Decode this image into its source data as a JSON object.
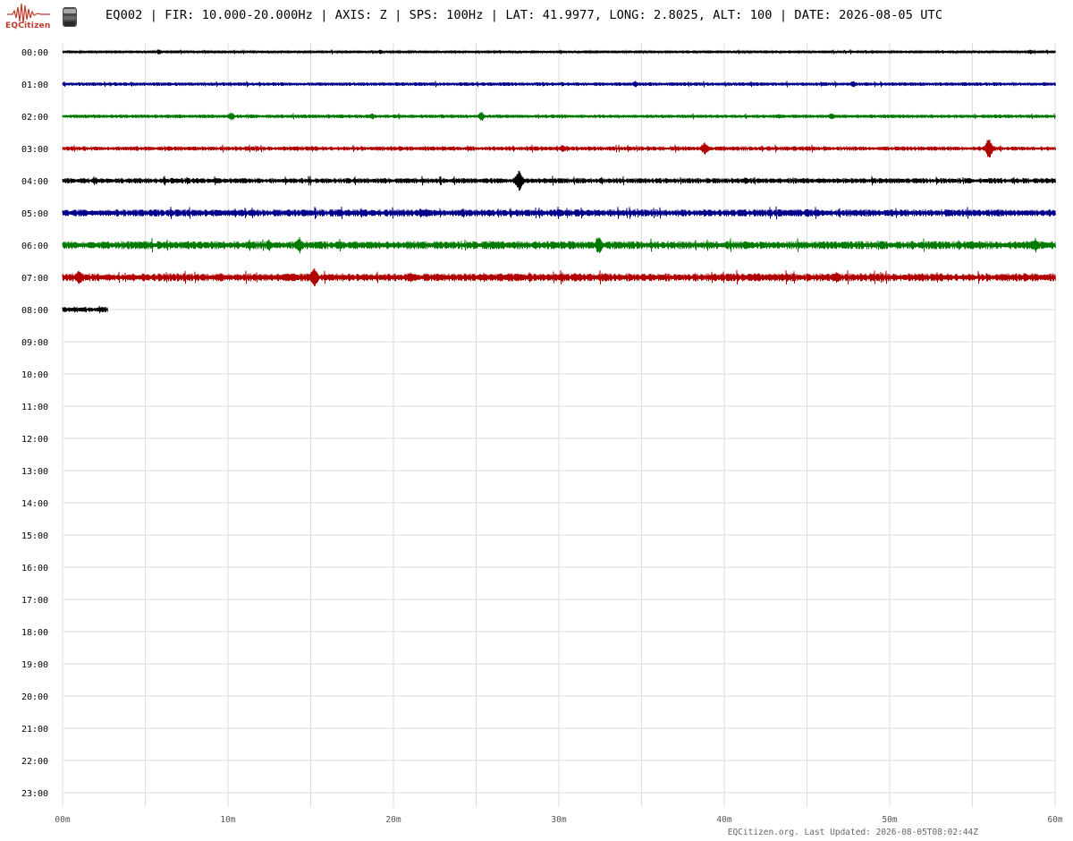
{
  "header": {
    "logo_text": "EQCitizen",
    "title": "EQ002 | FIR: 10.000-20.000Hz | AXIS: Z | SPS: 100Hz | LAT: 41.9977, LONG: 2.8025, ALT: 100 | DATE: 2026-08-05 UTC"
  },
  "footer": {
    "text": "EQCitizen.org. Last Updated: 2026-08-05T08:02:44Z"
  },
  "colors": {
    "trace_cycle": [
      "#000000",
      "#00008b",
      "#007a00",
      "#b00000"
    ],
    "grid": "#dddddd",
    "label": "#000000",
    "footer": "#666666",
    "logo": "#c0392b"
  },
  "chart_data": {
    "type": "line",
    "subtype": "helicorder",
    "title": "EQ002 | FIR: 10.000-20.000Hz | AXIS: Z | SPS: 100Hz | LAT: 41.9977, LONG: 2.8025, ALT: 100 | DATE: 2026-08-05 UTC",
    "xlabel": "",
    "ylabel": "",
    "xlim": [
      0,
      60
    ],
    "x_unit": "minutes",
    "x_ticks": [
      "00m",
      "10m",
      "20m",
      "30m",
      "40m",
      "50m",
      "60m"
    ],
    "y_ticks": [
      "00:00",
      "01:00",
      "02:00",
      "03:00",
      "04:00",
      "05:00",
      "06:00",
      "07:00",
      "08:00",
      "09:00",
      "10:00",
      "11:00",
      "12:00",
      "13:00",
      "14:00",
      "15:00",
      "16:00",
      "17:00",
      "18:00",
      "19:00",
      "20:00",
      "21:00",
      "22:00",
      "23:00"
    ],
    "grid": true,
    "series": [
      {
        "hour": "00:00",
        "end_minute": 60,
        "noise_level": 1.5,
        "events": [
          {
            "minute": 5.8,
            "amplitude": 3
          },
          {
            "minute": 19.2,
            "amplitude": 2.5
          },
          {
            "minute": 58.5,
            "amplitude": 3
          }
        ]
      },
      {
        "hour": "01:00",
        "end_minute": 60,
        "noise_level": 2,
        "events": [
          {
            "minute": 34.6,
            "amplitude": 4
          },
          {
            "minute": 47.8,
            "amplitude": 4
          }
        ]
      },
      {
        "hour": "02:00",
        "end_minute": 60,
        "noise_level": 2,
        "events": [
          {
            "minute": 10.2,
            "amplitude": 5
          },
          {
            "minute": 18.7,
            "amplitude": 4
          },
          {
            "minute": 25.3,
            "amplitude": 6
          },
          {
            "minute": 46.5,
            "amplitude": 4
          }
        ]
      },
      {
        "hour": "03:00",
        "end_minute": 60,
        "noise_level": 2.5,
        "events": [
          {
            "minute": 30.2,
            "amplitude": 5
          },
          {
            "minute": 38.8,
            "amplitude": 8
          },
          {
            "minute": 56.0,
            "amplitude": 14
          }
        ]
      },
      {
        "hour": "04:00",
        "end_minute": 60,
        "noise_level": 3,
        "events": [
          {
            "minute": 2.0,
            "amplitude": 4
          },
          {
            "minute": 27.6,
            "amplitude": 13
          },
          {
            "minute": 41.3,
            "amplitude": 5
          }
        ]
      },
      {
        "hour": "05:00",
        "end_minute": 60,
        "noise_level": 4,
        "events": [
          {
            "minute": 22.0,
            "amplitude": 6
          },
          {
            "minute": 45.0,
            "amplitude": 6
          }
        ]
      },
      {
        "hour": "06:00",
        "end_minute": 60,
        "noise_level": 4.5,
        "events": [
          {
            "minute": 14.3,
            "amplitude": 10
          },
          {
            "minute": 32.4,
            "amplitude": 12
          },
          {
            "minute": 58.8,
            "amplitude": 9
          }
        ]
      },
      {
        "hour": "07:00",
        "end_minute": 60,
        "noise_level": 4.5,
        "events": [
          {
            "minute": 1.0,
            "amplitude": 9
          },
          {
            "minute": 15.2,
            "amplitude": 16
          },
          {
            "minute": 46.8,
            "amplitude": 7
          }
        ]
      },
      {
        "hour": "08:00",
        "end_minute": 2.73,
        "noise_level": 3,
        "events": []
      }
    ]
  }
}
